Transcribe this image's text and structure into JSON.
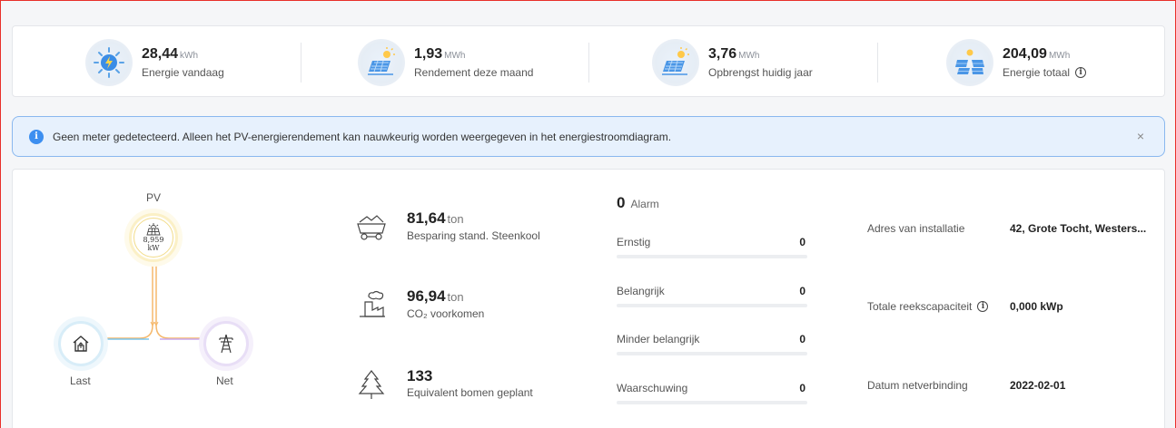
{
  "kpis": [
    {
      "value": "28,44",
      "unit": "kWh",
      "label": "Energie vandaag",
      "icon": "lightning-sun-icon"
    },
    {
      "value": "1,93",
      "unit": "MWh",
      "label": "Rendement deze maand",
      "icon": "solar-panel-icon"
    },
    {
      "value": "3,76",
      "unit": "MWh",
      "label": "Opbrengst huidig jaar",
      "icon": "solar-panel-icon"
    },
    {
      "value": "204,09",
      "unit": "MWh",
      "label": "Energie totaal",
      "icon": "solar-array-icon",
      "info": "i"
    }
  ],
  "alert": {
    "icon": "i",
    "text": "Geen meter gedetecteerd. Alleen het PV-energierendement kan nauwkeurig worden weergegeven in het energiestroomdiagram.",
    "close": "×"
  },
  "flow": {
    "pv_label": "PV",
    "pv_value": "8,959",
    "pv_unit": "kW",
    "last_label": "Last",
    "net_label": "Net",
    "colors": {
      "pv": "#f5b86b",
      "last": "#7cc6ee",
      "net": "#c9a9ee"
    }
  },
  "stats": [
    {
      "value": "81,64",
      "unit": "ton",
      "label": "Besparing stand. Steenkool",
      "icon": "coal-cart-icon"
    },
    {
      "value": "96,94",
      "unit": "ton",
      "label": "CO₂ voorkomen",
      "icon": "factory-icon"
    },
    {
      "value": "133",
      "unit": "",
      "label": "Equivalent bomen geplant",
      "icon": "tree-icon"
    }
  ],
  "alarms": {
    "count": "0",
    "label": "Alarm",
    "rows": [
      {
        "name": "Ernstig",
        "value": "0"
      },
      {
        "name": "Belangrijk",
        "value": "0"
      },
      {
        "name": "Minder belangrijk",
        "value": "0"
      },
      {
        "name": "Waarschuwing",
        "value": "0"
      }
    ]
  },
  "info": [
    {
      "label": "Adres van installatie",
      "value": "42, Grote Tocht, Westers..."
    },
    {
      "label": "Totale reekscapaciteit",
      "value": "0,000 kWp",
      "info": "i"
    },
    {
      "label": "Datum netverbinding",
      "value": "2022-02-01"
    }
  ]
}
